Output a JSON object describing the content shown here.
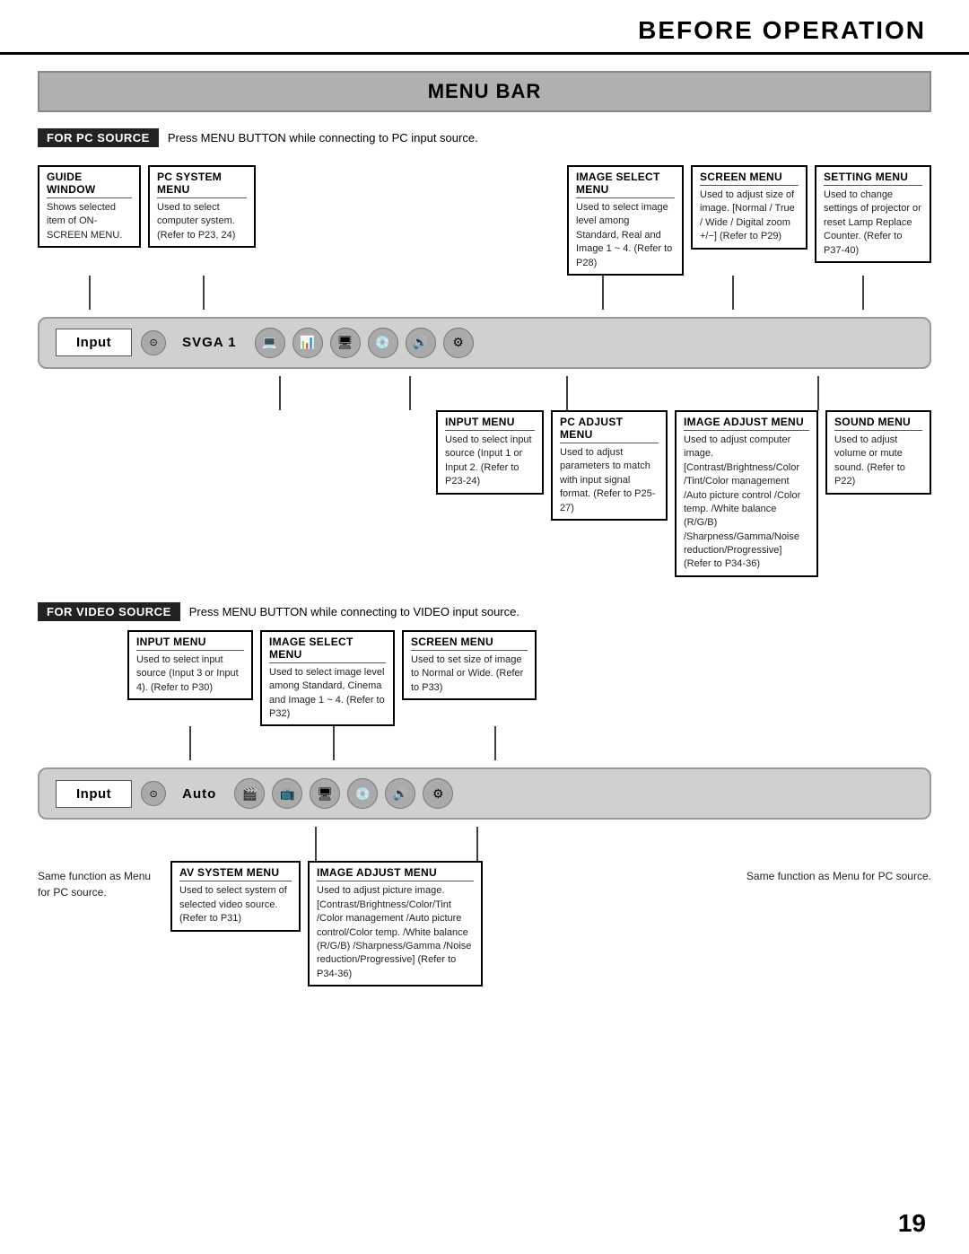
{
  "header": {
    "title": "BEFORE OPERATION"
  },
  "menu_bar": {
    "title": "MENU BAR"
  },
  "pc_source": {
    "label": "FOR PC SOURCE",
    "desc": "Press MENU BUTTON while connecting to PC input source.",
    "projector_input": "Input",
    "projector_signal": "SVGA 1",
    "menus_top": [
      {
        "id": "guide-window",
        "title": "GUIDE WINDOW",
        "text": "Shows selected item of ON-SCREEN MENU."
      },
      {
        "id": "pc-system-menu",
        "title": "PC SYSTEM MENU",
        "text": "Used to select computer system. (Refer to P23, 24)"
      },
      {
        "id": "image-select-menu-pc",
        "title": "IMAGE SELECT MENU",
        "text": "Used to select image level among Standard, Real and Image 1 ~ 4. (Refer to P28)"
      },
      {
        "id": "screen-menu-pc",
        "title": "SCREEN MENU",
        "text": "Used to adjust size of image. [Normal / True / Wide / Digital zoom +/−] (Refer to P29)"
      },
      {
        "id": "setting-menu",
        "title": "SETTING MENU",
        "text": "Used to change settings of projector or reset Lamp Replace Counter. (Refer to P37-40)"
      }
    ],
    "menus_bottom": [
      {
        "id": "input-menu-pc",
        "title": "INPUT MENU",
        "text": "Used to select input source (Input 1 or Input 2. (Refer to P23-24)"
      },
      {
        "id": "pc-adjust-menu",
        "title": "PC ADJUST MENU",
        "text": "Used to adjust parameters to match with input signal format. (Refer to P25-27)"
      },
      {
        "id": "image-adjust-menu-pc",
        "title": "IMAGE ADJUST MENU",
        "text": "Used to adjust computer image. [Contrast/Brightness/Color /Tint/Color management /Auto picture control /Color temp. /White balance (R/G/B) /Sharpness/Gamma/Noise reduction/Progressive] (Refer to P34-36)"
      },
      {
        "id": "sound-menu-pc",
        "title": "SOUND MENU",
        "text": "Used to adjust volume or mute sound. (Refer to P22)"
      }
    ]
  },
  "video_source": {
    "label": "FOR VIDEO SOURCE",
    "desc": "Press MENU BUTTON while connecting to VIDEO input source.",
    "projector_input": "Input",
    "projector_signal": "Auto",
    "same_function_left": "Same function as Menu for PC source.",
    "same_function_right": "Same function as Menu for PC source.",
    "menus_top": [
      {
        "id": "input-menu-video",
        "title": "INPUT MENU",
        "text": "Used to select input source (Input 3 or Input 4). (Refer to P30)"
      },
      {
        "id": "image-select-menu-video",
        "title": "IMAGE SELECT MENU",
        "text": "Used to select image level among Standard, Cinema and Image 1 ~ 4. (Refer to P32)"
      },
      {
        "id": "screen-menu-video",
        "title": "SCREEN MENU",
        "text": "Used to set size of image to Normal or Wide. (Refer to P33)"
      }
    ],
    "menus_bottom": [
      {
        "id": "av-system-menu",
        "title": "AV SYSTEM MENU",
        "text": "Used to select system of selected video source. (Refer to P31)"
      },
      {
        "id": "image-adjust-menu-video",
        "title": "IMAGE ADJUST MENU",
        "text": "Used to adjust picture image. [Contrast/Brightness/Color/Tint /Color management /Auto picture control/Color temp. /White balance (R/G/B) /Sharpness/Gamma /Noise reduction/Progressive] (Refer to P34-36)"
      }
    ]
  },
  "page_number": "19"
}
